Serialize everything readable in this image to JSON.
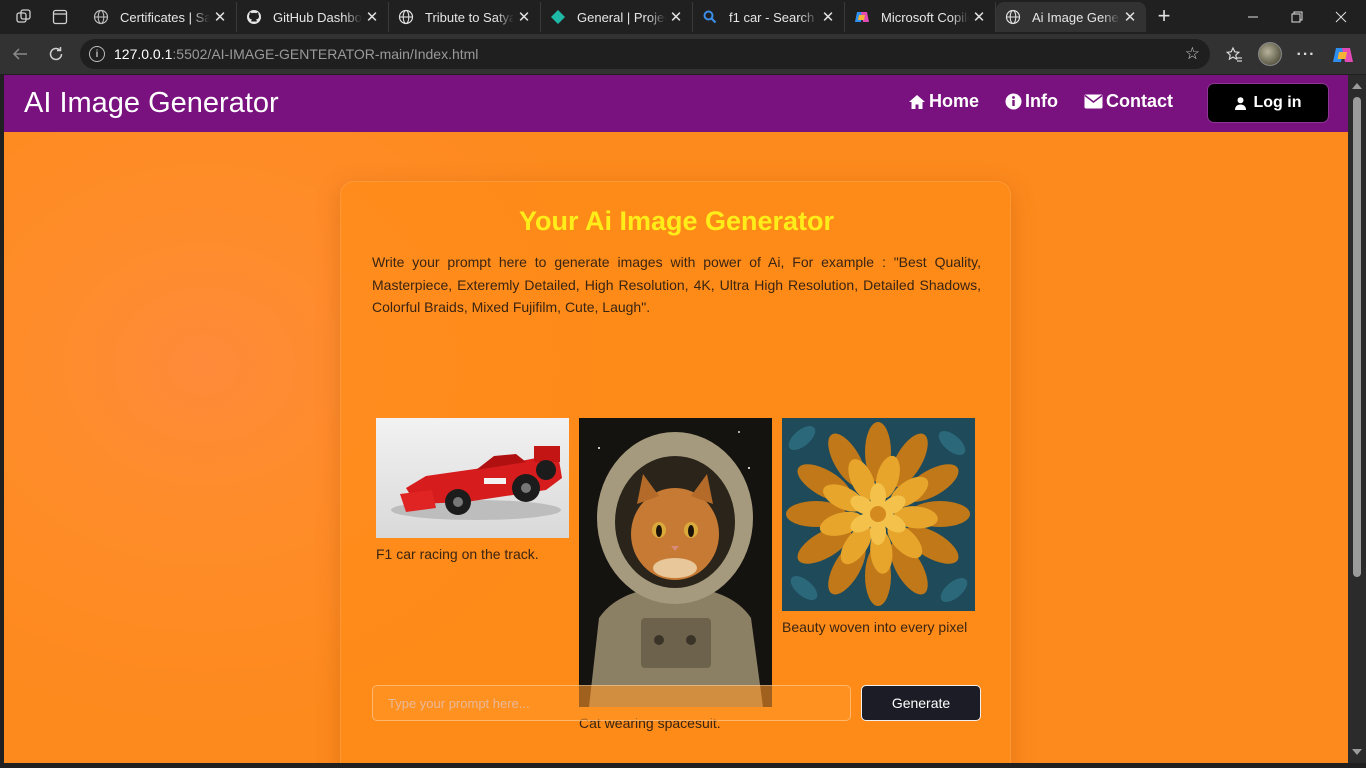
{
  "browser": {
    "tabs": [
      {
        "label": "Certificates | Sarv",
        "icon": "globe-icon"
      },
      {
        "label": "GitHub Dashboard",
        "icon": "github-icon"
      },
      {
        "label": "Tribute to Satya N",
        "icon": "globe-icon"
      },
      {
        "label": "General | Project",
        "icon": "diamond-icon"
      },
      {
        "label": "f1 car - Search",
        "icon": "search-icon"
      },
      {
        "label": "Microsoft Copilot",
        "icon": "copilot-icon"
      },
      {
        "label": "Ai Image Generat",
        "icon": "globe-icon",
        "active": true
      }
    ],
    "url_host": "127.0.0.1",
    "url_rest": ":5502/AI-IMAGE-GENTERATOR-main/Index.html"
  },
  "page": {
    "brand": "AI Image Generator",
    "nav": {
      "home": "Home",
      "info": "Info",
      "contact": "Contact",
      "login": "Log in"
    },
    "card": {
      "title": "Your Ai Image Generator",
      "description": "Write your prompt here to generate images with power of Ai, For example : \"Best Quality, Masterpiece, Exteremly Detailed, High Resolution, 4K, Ultra High Resolution, Detailed Shadows, Colorful Braids, Mixed Fujifilm, Cute, Laugh\".",
      "gallery": [
        {
          "caption": "F1 car racing on the track."
        },
        {
          "caption": "Cat wearing spacesuit."
        },
        {
          "caption": "Beauty woven into every pixel"
        }
      ],
      "prompt_placeholder": "Type your prompt here...",
      "generate_label": "Generate"
    }
  },
  "colors": {
    "header": "#79127f",
    "background": "#fd8a1d",
    "title": "#ffed1a",
    "button": "#1c1c26"
  }
}
